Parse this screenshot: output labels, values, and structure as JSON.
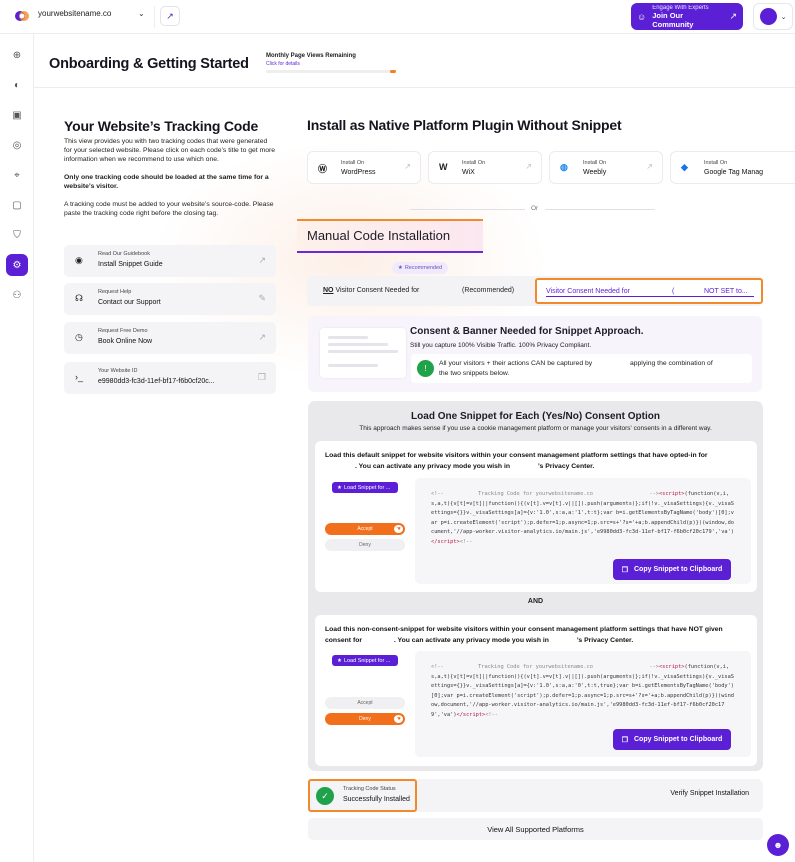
{
  "topbar": {
    "site_name": "yourwebsitename.co",
    "community_small": "Engage With Experts",
    "community_big": "Join Our Community"
  },
  "colors": {
    "brand": "#5b1fd6",
    "accent_orange": "#f08a2a",
    "success": "#1fa24a"
  },
  "header": {
    "title": "Onboarding & Getting Started",
    "page_views_label": "Monthly Page Views Remaining",
    "page_views_link": "Click for details"
  },
  "left": {
    "title": "Your Website’s Tracking Code",
    "p1": "This view provides you with two tracking codes that were generated for your selected website. Please click on each code’s title to get more information when we recommend to use which one.",
    "p2": "Only one tracking code should be loaded at the same time for a website’s visitor.",
    "p3": "A tracking code must be added to your website’s source-code. Please paste the tracking code right before the closing tag.",
    "cards": [
      {
        "small": "Read Our Guidebook",
        "main": "Install Snippet Guide",
        "icon": "book-icon"
      },
      {
        "small": "Request Help",
        "main": "Contact our Support",
        "icon": "support-icon"
      },
      {
        "small": "Request Free Demo",
        "main": "Book Online Now",
        "icon": "clock-icon"
      },
      {
        "small": "Your Website ID",
        "main": "e9980dd3-fc3d-11ef-bf17-f6b0cf20c...",
        "icon": "code-icon"
      }
    ]
  },
  "native": {
    "title": "Install as Native Platform Plugin Without Snippet",
    "platforms": [
      {
        "small": "Install On",
        "main": "WordPress",
        "icon": "wordpress-icon"
      },
      {
        "small": "Install On",
        "main": "WiX",
        "icon": "wix-icon"
      },
      {
        "small": "Install On",
        "main": "Weebly",
        "icon": "weebly-icon"
      },
      {
        "small": "Install On",
        "main": "Google Tag Manag",
        "icon": "gtm-icon"
      }
    ],
    "or": "Or"
  },
  "manual": {
    "title": "Manual Code Installation",
    "recommended": "Recommended",
    "tab_no_prefix": "NO",
    "tab_no_rest": "Visitor Consent Needed for",
    "tab_no_suffix": "(Recommended)",
    "tab_yes": "Visitor Consent Needed for",
    "tab_yes_paren": "(",
    "tab_yes_status": "NOT SET to...",
    "banner_title": "Consent & Banner Needed for Snippet Approach.",
    "banner_sub": "Still you capture 100% Visible Traffic. 100% Privacy Compliant.",
    "banner_note_a": "All your visitors + their actions CAN be captured by",
    "banner_note_b": "applying the combination of",
    "banner_note_c": "the two snippets below."
  },
  "approach": {
    "title": "Load One Snippet for Each (Yes/No) Consent Option",
    "subtitle": "This approach makes sense if you use a cookie management platform or manage your visitors' consents in a different way.",
    "and": "AND",
    "snippet1": {
      "desc_a": "Load this default snippet for website visitors within your consent management platform settings that have opted-in for",
      "desc_b": ". You can activate any privacy mode you wish in",
      "desc_c": "’s Privacy Center.",
      "load_label": "Load Snippet for ...",
      "accept": "Accept",
      "deny": "Deny",
      "code_comment_a": "<!--",
      "code_comment_label": "Tracking Code for",
      "code_site": "yourwebsitename.co",
      "code_comment_end": "-->",
      "code_body": "(function(v,i,s,a,t){v[t]=v[t]||function(){(v[t].v=v[t].v||[]).push(arguments)};if(!v._visaSettings){v._visaSettings={}}v._visaSettings[a]={v:'1.0',s:a,a:'1',t:t};var b=i.getElementsByTagName('body')[0];var p=i.createElement('script');p.defer=1;p.async=1;p.src=s+'?s='+a;b.appendChild(p)})(window,document,'//app-worker.visitor-analytics.io/main.js','e9980dd3-fc3d-11ef-bf17-f6b0cf20c179','va')",
      "copy": "Copy Snippet to Clipboard"
    },
    "snippet2": {
      "desc_a": "Load this non-consent-snippet for website visitors within your consent management platform settings that have NOT given consent for",
      "desc_b": ". You can activate any privacy mode you wish in",
      "desc_c": "’s Privacy Center.",
      "load_label": "Load Snippet for ...",
      "accept": "Accept",
      "deny": "Deny",
      "code_comment_a": "<!--",
      "code_comment_label": "Tracking Code for",
      "code_site": "yourwebsitename.co",
      "code_comment_end": "-->",
      "code_body": "(function(v,i,s,a,t){v[t]=v[t]||function(){(v[t].v=v[t].v||[]).push(arguments)};if(!v._visaSettings){v._visaSettings={}}v._visaSettings[a]={v:'1.0',s:a,a:'0',t:t,true};var b=i.getElementsByTagName('body')[0];var p=i.createElement('script');p.defer=1;p.async=1;p.src=s+'?s='+a;b.appendChild(p)})(window,document,'//app-worker.visitor-analytics.io/main.js','e9980dd3-fc3d-11ef-bf17-f6b0cf20c179','va')",
      "copy": "Copy Snippet to Clipboard"
    }
  },
  "status": {
    "label": "Tracking Code Status",
    "value": "Successfully Installed",
    "verify": "Verify Snippet Installation",
    "view_all": "View All Supported Platforms"
  }
}
